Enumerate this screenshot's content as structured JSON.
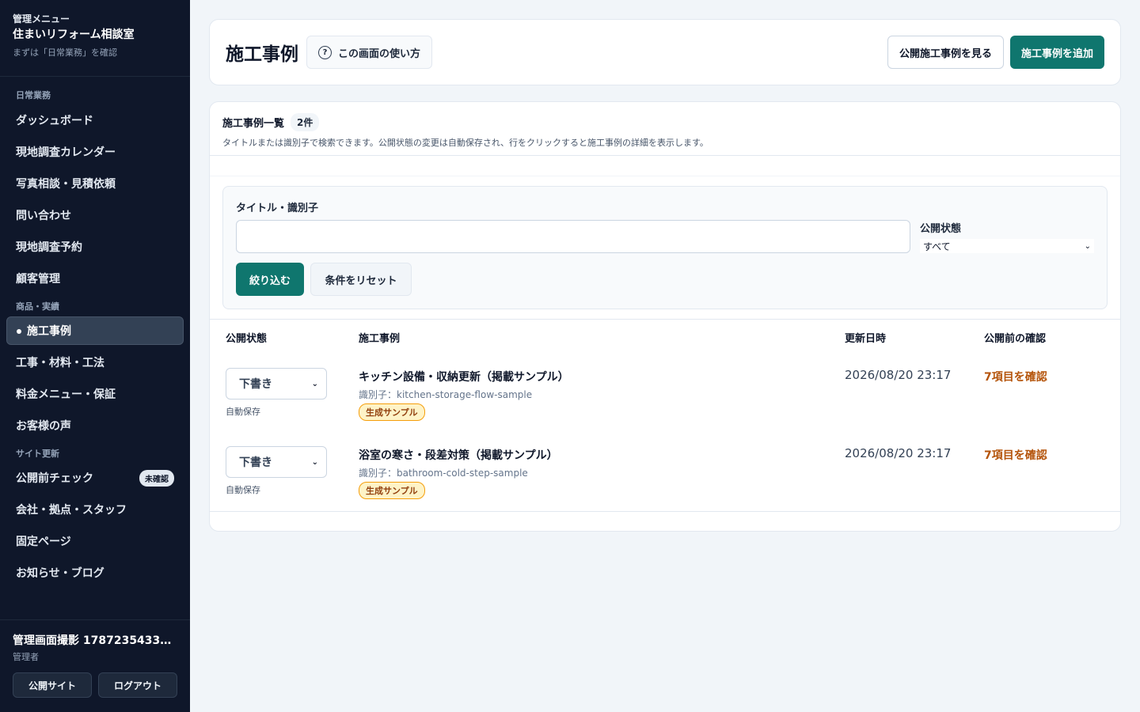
{
  "sidebar": {
    "kicker": "管理メニュー",
    "site_name": "住まいリフォーム相談室",
    "hint": "まずは「日常業務」を確認",
    "sections": [
      {
        "label": "日常業務",
        "items": [
          "ダッシュボード",
          "現地調査カレンダー",
          "写真相談・見積依頼",
          "問い合わせ",
          "現地調査予約",
          "顧客管理"
        ]
      },
      {
        "label": "商品・実績",
        "items": [
          "施工事例",
          "工事・材料・工法",
          "料金メニュー・保証",
          "お客様の声"
        ]
      },
      {
        "label": "サイト更新",
        "items": [
          "公開前チェック",
          "会社・拠点・スタッフ",
          "固定ページ",
          "お知らせ・ブログ"
        ]
      }
    ],
    "active_item": "施工事例",
    "badge": "未確認",
    "user_name": "管理画面撮影 17872354334...",
    "user_role": "管理者",
    "public_site_button": "公開サイト",
    "logout_button": "ログアウト"
  },
  "header": {
    "title": "施工事例",
    "help_label": "この画面の使い方",
    "help_icon": "?",
    "view_public_button": "公開施工事例を見る",
    "add_button": "施工事例を追加"
  },
  "list": {
    "title": "施工事例一覧",
    "count": "2件",
    "description": "タイトルまたは識別子で検索できます。公開状態の変更は自動保存され、行をクリックすると施工事例の詳細を表示します。",
    "filter": {
      "keyword_label": "タイトル・識別子",
      "keyword_value": "",
      "status_label": "公開状態",
      "status_value": "すべて",
      "filter_button": "絞り込む",
      "reset_button": "条件をリセット"
    },
    "columns": [
      "公開状態",
      "施工事例",
      "更新日時",
      "公開前の確認"
    ],
    "rows": [
      {
        "status": "下書き",
        "autosave": "自動保存",
        "title": "キッチン設備・収納更新（掲載サンプル）",
        "identifier": "識別子：kitchen-storage-flow-sample",
        "tag": "生成サンプル",
        "updated": "2026/08/20 23:17",
        "check": "7項目を確認"
      },
      {
        "status": "下書き",
        "autosave": "自動保存",
        "title": "浴室の寒さ・段差対策（掲載サンプル）",
        "identifier": "識別子：bathroom-cold-step-sample",
        "tag": "生成サンプル",
        "updated": "2026/08/20 23:17",
        "check": "7項目を確認"
      }
    ]
  },
  "colors": {
    "accent": "#0f766e",
    "sidebar_bg": "#0f172a",
    "warning": "#b45309"
  }
}
